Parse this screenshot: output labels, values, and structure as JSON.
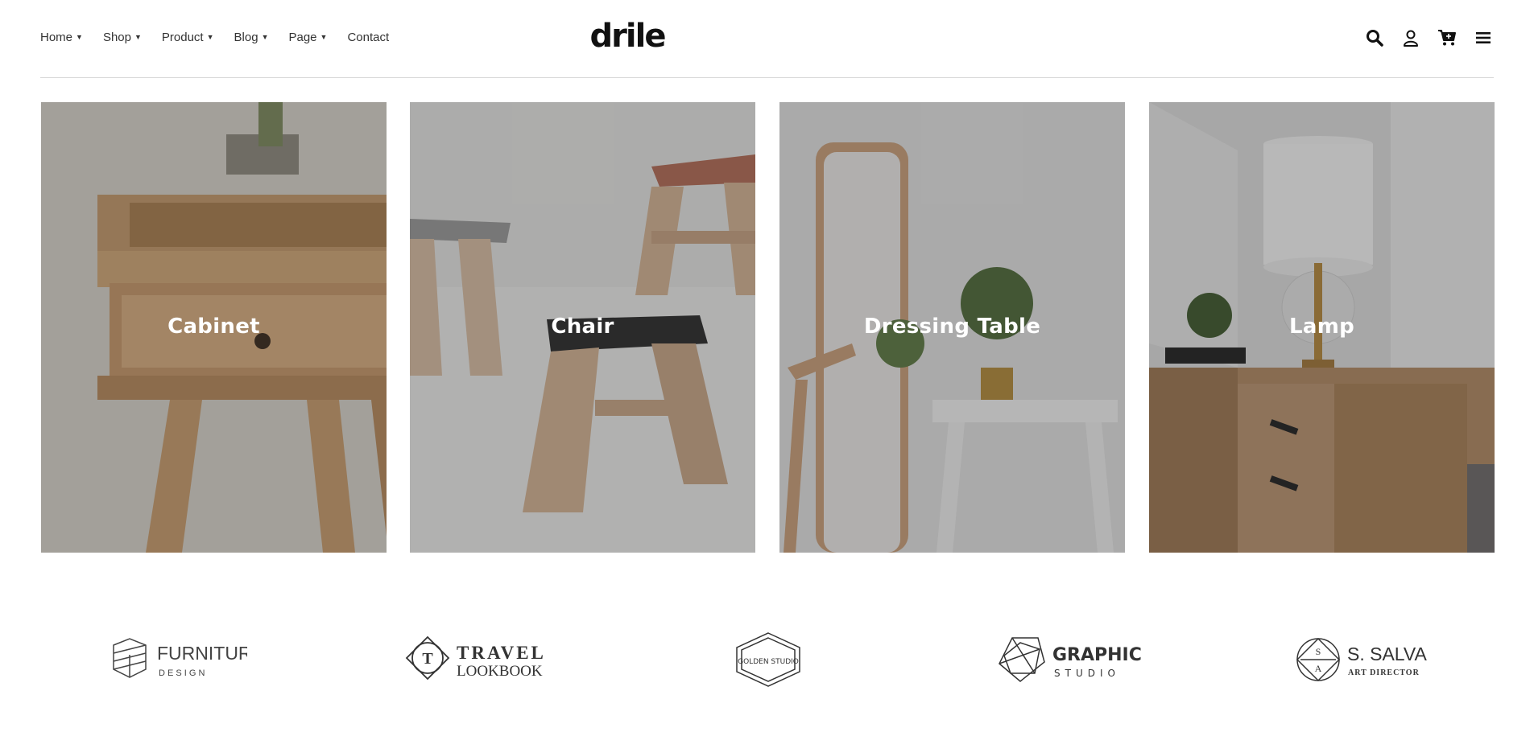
{
  "header": {
    "nav": [
      {
        "label": "Home",
        "has_dropdown": true
      },
      {
        "label": "Shop",
        "has_dropdown": true
      },
      {
        "label": "Product",
        "has_dropdown": true
      },
      {
        "label": "Blog",
        "has_dropdown": true
      },
      {
        "label": "Page",
        "has_dropdown": true
      },
      {
        "label": "Contact",
        "has_dropdown": false
      }
    ],
    "logo": "drile",
    "icons": [
      "search-icon",
      "user-icon",
      "cart-icon",
      "menu-icon"
    ]
  },
  "categories": [
    {
      "label": "Cabinet"
    },
    {
      "label": "Chair"
    },
    {
      "label": "Dressing Table"
    },
    {
      "label": "Lamp"
    }
  ],
  "brands": [
    {
      "line1": "FURNITURE",
      "line2": "D E S I G N"
    },
    {
      "line1": "TRAVEL",
      "line2": "LOOKBOOK",
      "mark": "T"
    },
    {
      "line1": "GOLDEN STUDIO"
    },
    {
      "line1": "GRAPHIC",
      "line2": "STUDIO"
    },
    {
      "line1": "S. SALVA",
      "line2": "ART DIRECTOR",
      "mark_top": "S",
      "mark_bottom": "A"
    }
  ],
  "colors": {
    "text": "#333333",
    "divider": "#d9d9d9",
    "overlay": "rgba(40,40,40,0.30)"
  }
}
